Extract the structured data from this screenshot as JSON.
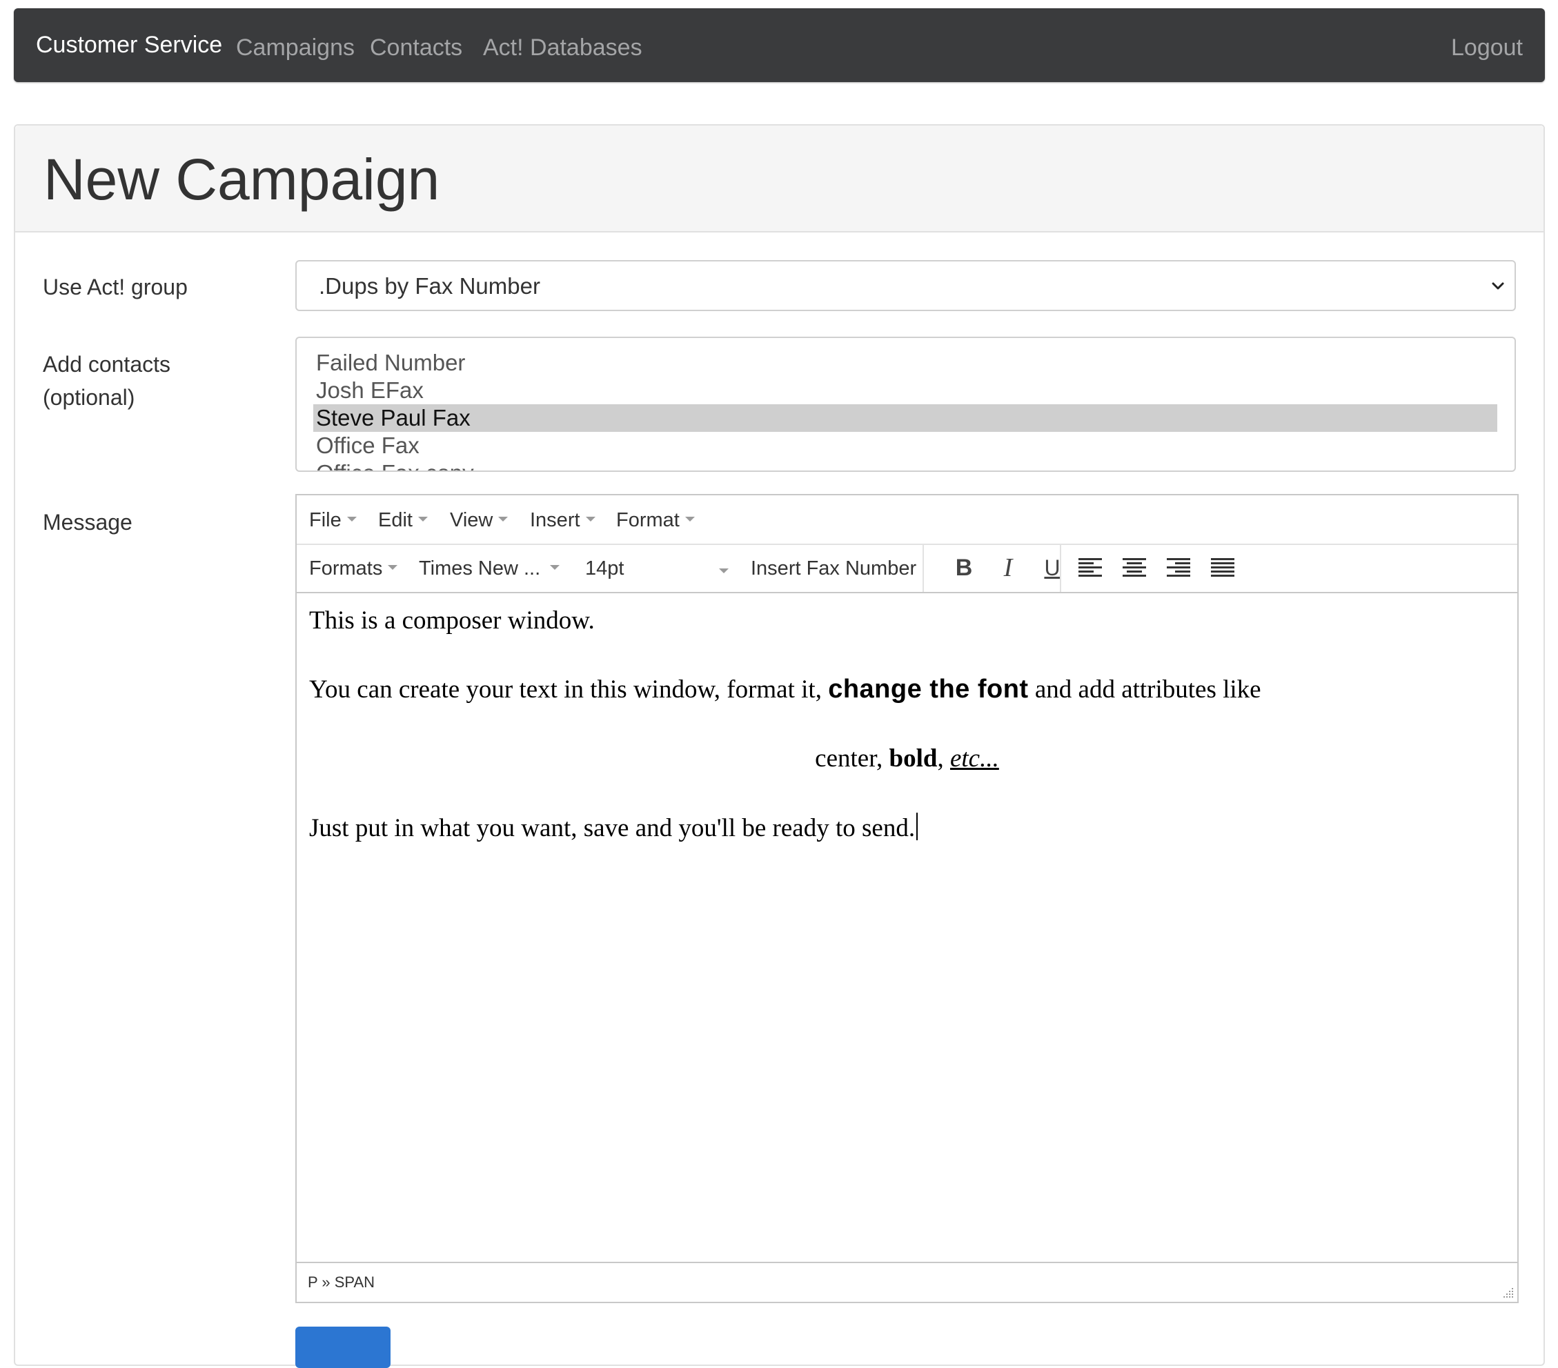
{
  "navbar": {
    "brand": "Customer Service",
    "links": [
      "Campaigns",
      "Contacts",
      "Act! Databases"
    ],
    "logout": "Logout"
  },
  "page": {
    "title": "New Campaign"
  },
  "form": {
    "group_label": "Use Act! group",
    "group_selected": ".Dups by Fax Number",
    "contacts_label_line1": "Add contacts",
    "contacts_label_line2": "(optional)",
    "contacts": [
      {
        "name": "Failed Number",
        "selected": false
      },
      {
        "name": "Josh EFax",
        "selected": false
      },
      {
        "name": "Steve Paul Fax",
        "selected": true
      },
      {
        "name": "Office Fax",
        "selected": false
      },
      {
        "name": "Office Fax copy",
        "selected": false
      }
    ],
    "message_label": "Message"
  },
  "editor": {
    "menu": [
      "File",
      "Edit",
      "View",
      "Insert",
      "Format"
    ],
    "toolbar": {
      "formats": "Formats",
      "font_family": "Times New ...",
      "font_size": "14pt",
      "insert_fax": "Insert Fax Number",
      "bold_icon": "bold-icon",
      "italic_icon": "italic-icon",
      "underline_icon": "underline-icon",
      "align_icons": [
        "align-left-icon",
        "align-center-icon",
        "align-right-icon",
        "align-justify-icon"
      ]
    },
    "content": {
      "line1": "This is a composer window.",
      "line2_a": "You can create your text in this window, format it, ",
      "line2_b": "change the font",
      "line2_c": " and add attributes like",
      "line3_a": "center, ",
      "line3_b": "bold",
      "line3_c": ", ",
      "line3_d": "etc...",
      "line4": "Just put in what you want, save and you'll be ready to send."
    },
    "status_path": "P » SPAN"
  },
  "colors": {
    "navbar_bg": "#3a3b3d",
    "primary_button": "#2c76d2",
    "selected_option": "#cfcfcf"
  }
}
